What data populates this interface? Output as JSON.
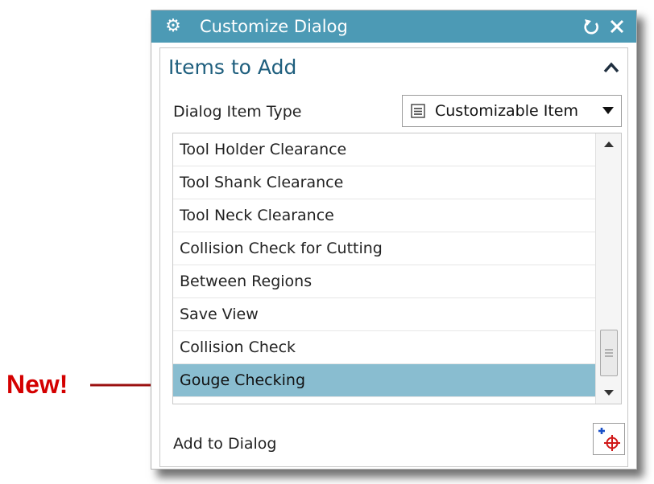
{
  "annotation": {
    "text": "New!",
    "color": "#d40000"
  },
  "dialog": {
    "title": "Customize Dialog",
    "title_bar_color": "#4c9ab5",
    "icons": {
      "title": "gear-icon",
      "reset": "reset-icon",
      "close": "close-icon"
    },
    "section": {
      "title": "Items to Add",
      "collapse_icon": "chevron-up-icon"
    },
    "item_type": {
      "label": "Dialog Item Type",
      "selected_value": "Customizable Item",
      "icon": "form-icon"
    },
    "items": [
      {
        "label": "Tool Holder Clearance",
        "selected": false
      },
      {
        "label": "Tool Shank Clearance",
        "selected": false
      },
      {
        "label": "Tool Neck Clearance",
        "selected": false
      },
      {
        "label": "Collision Check for Cutting",
        "selected": false
      },
      {
        "label": "Between Regions",
        "selected": false
      },
      {
        "label": "Save View",
        "selected": false
      },
      {
        "label": "Collision Check",
        "selected": false
      },
      {
        "label": "Gouge Checking",
        "selected": true
      }
    ],
    "selection_color": "#89bdd0",
    "add_to_dialog": {
      "label": "Add to Dialog",
      "icon": "add-item-icon"
    }
  }
}
